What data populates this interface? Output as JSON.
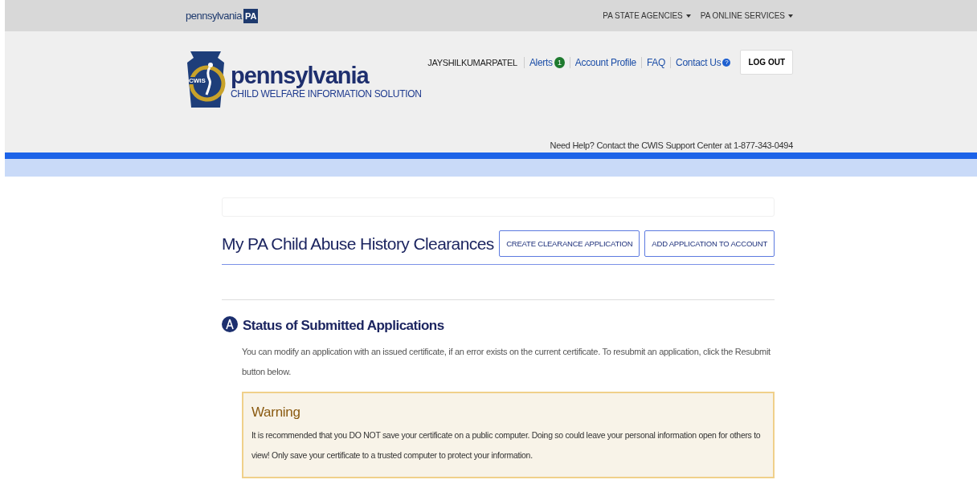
{
  "top_bar": {
    "brand": "pennsylvania",
    "brand_badge": "PA",
    "menus": [
      {
        "label": "PA STATE AGENCIES"
      },
      {
        "label": "PA ONLINE SERVICES"
      }
    ]
  },
  "header": {
    "logo_badge": "CWIS",
    "logo_title": "pennsylvania",
    "logo_subtitle": "CHILD WELFARE INFORMATION SOLUTION",
    "username": "JAYSHILKUMARPATEL",
    "links": [
      {
        "label": "Alerts",
        "kind": "badge",
        "badge": "1"
      },
      {
        "label": "Account Profile",
        "kind": "plain"
      },
      {
        "label": "FAQ",
        "kind": "plain"
      },
      {
        "label": "Contact Us",
        "kind": "help",
        "badge": "?"
      }
    ],
    "logout": "LOG OUT",
    "help_text": "Need Help? Contact the CWIS Support Center at 1-877-343-0494"
  },
  "page": {
    "title": "My PA Child Abuse History Clearances",
    "buttons": [
      "CREATE CLEARANCE APPLICATION",
      "ADD APPLICATION TO ACCOUNT"
    ]
  },
  "section": {
    "title": "Status of Submitted Applications",
    "text": "You can modify an application with an issued certificate, if an error exists on the current certificate. To resubmit an application, click the Resubmit button below.",
    "warning": {
      "title": "Warning",
      "text": "It is recommended that you DO NOT save your certificate on a public computer. Doing so could leave your personal information open for others to view! Only save your certificate to a trusted computer to protect your information."
    }
  }
}
